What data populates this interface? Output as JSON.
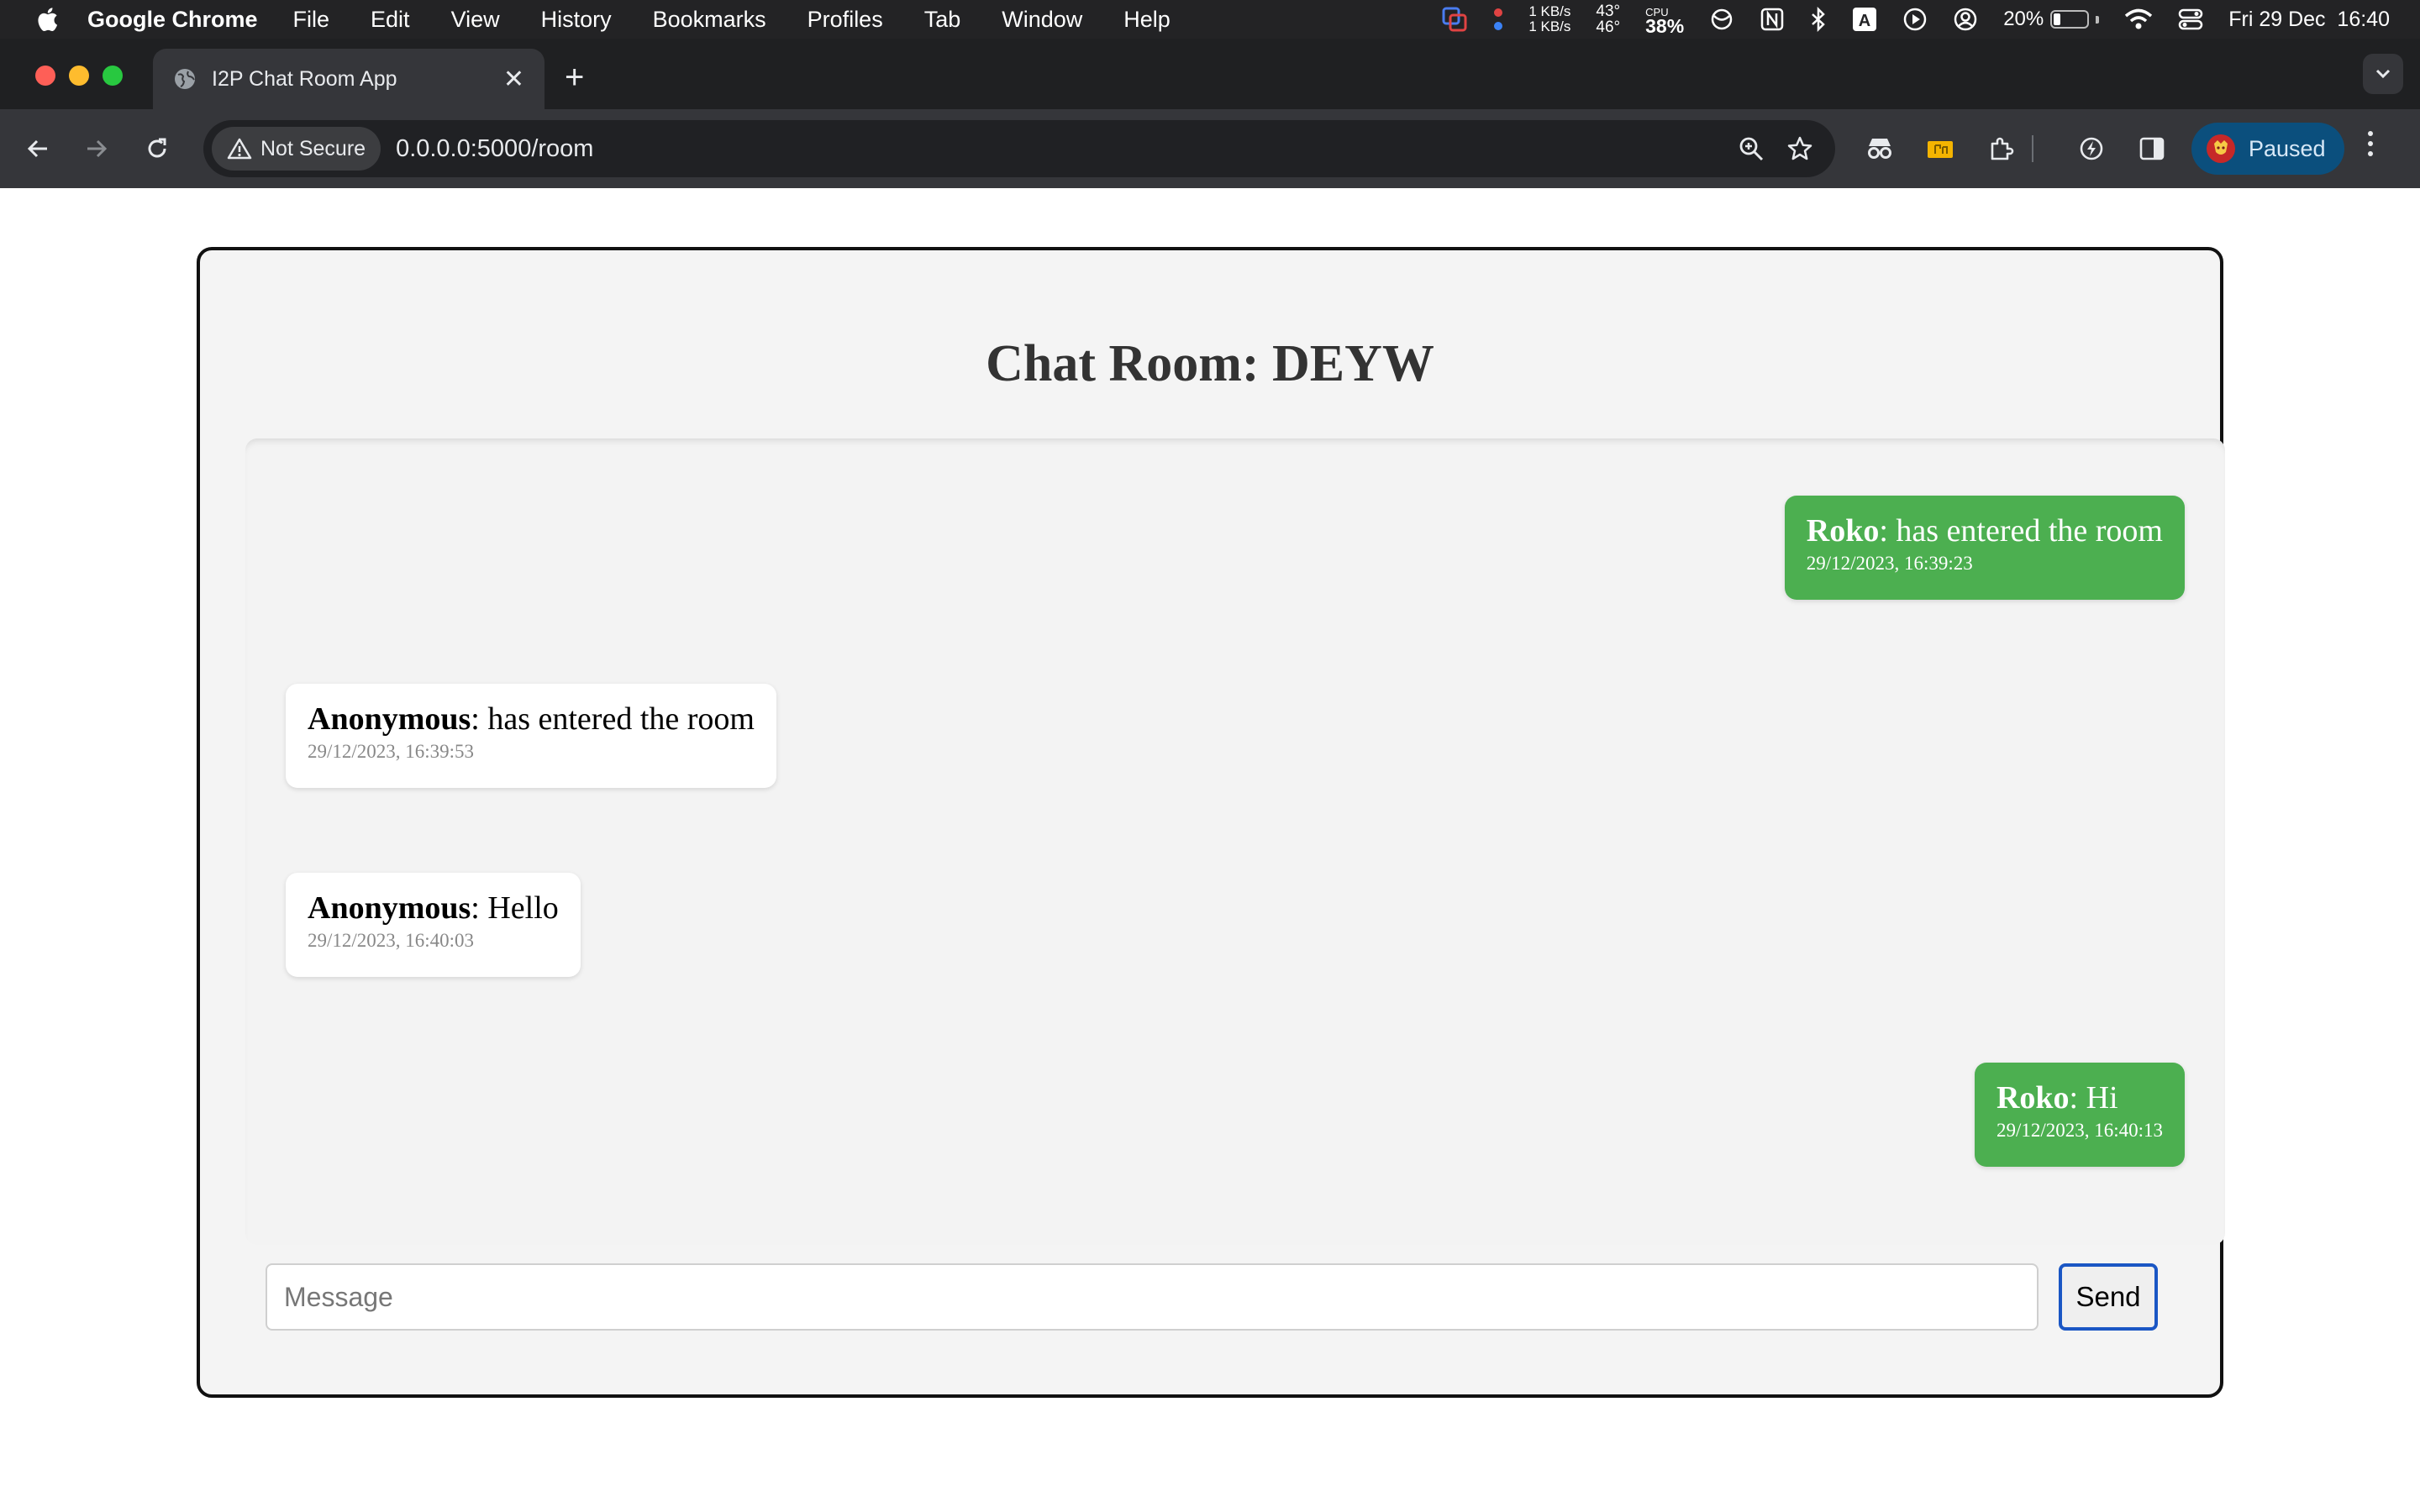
{
  "menubar": {
    "app_name": "Google Chrome",
    "menus": [
      "File",
      "Edit",
      "View",
      "History",
      "Bookmarks",
      "Profiles",
      "Tab",
      "Window",
      "Help"
    ],
    "net_up": "1 KB/s",
    "net_down": "1 KB/s",
    "temp_1": "43°",
    "temp_2": "46°",
    "cpu_label": "CPU",
    "cpu_value": "38%",
    "keyboard_letter": "A",
    "battery_percent": "20%",
    "battery_level": 0.2,
    "datetime": "Fri 29 Dec  16:40"
  },
  "browser": {
    "tab_title": "I2P Chat Room App",
    "new_tab_symbol": "+",
    "tab_close_symbol": "✕",
    "security_label": "Not Secure",
    "url": "0.0.0.0:5000/room",
    "profile_status": "Paused"
  },
  "room": {
    "title": "Chat Room: DEYW",
    "messages": [
      {
        "sender": "Roko",
        "text": ": has entered the room",
        "timestamp": "29/12/2023, 16:39:23",
        "mine": true
      },
      {
        "sender": "Anonymous",
        "text": ": has entered the room",
        "timestamp": "29/12/2023, 16:39:53",
        "mine": false
      },
      {
        "sender": "Anonymous",
        "text": ": Hello",
        "timestamp": "29/12/2023, 16:40:03",
        "mine": false
      },
      {
        "sender": "Roko",
        "text": ": Hi",
        "timestamp": "29/12/2023, 16:40:13",
        "mine": true
      }
    ],
    "input_placeholder": "Message",
    "input_value": "",
    "send_label": "Send"
  },
  "colors": {
    "own_message_bg": "#4caf50",
    "other_message_bg": "#ffffff",
    "send_border": "#1a56c4",
    "profile_chip_bg": "#0b4f7d"
  }
}
